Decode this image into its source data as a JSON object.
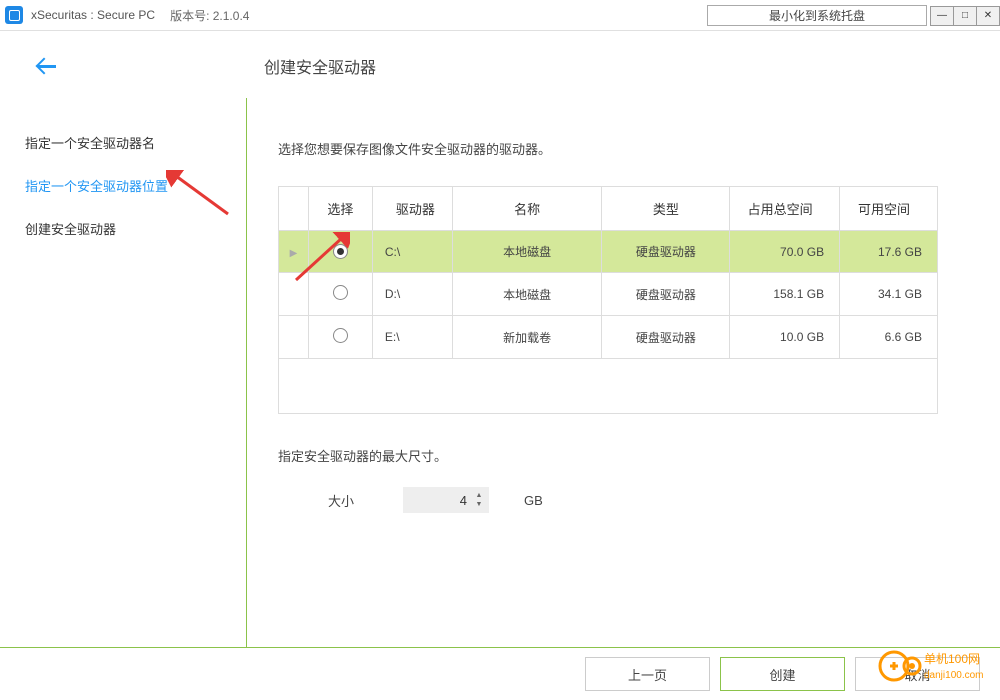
{
  "titlebar": {
    "app_name": "xSecuritas : Secure PC",
    "version_label": "版本号:",
    "version_value": "2.1.0.4",
    "tray_button": "最小化到系统托盘"
  },
  "header": {
    "page_title": "创建安全驱动器"
  },
  "sidebar": {
    "items": [
      {
        "label": "指定一个安全驱动器名",
        "active": false
      },
      {
        "label": "指定一个安全驱动器位置",
        "active": true
      },
      {
        "label": "创建安全驱动器",
        "active": false
      }
    ]
  },
  "main": {
    "description": "选择您想要保存图像文件安全驱动器的驱动器。",
    "table": {
      "headers": {
        "select": "选择",
        "drive": "驱动器",
        "name": "名称",
        "type": "类型",
        "total": "占用总空间",
        "available": "可用空间"
      },
      "rows": [
        {
          "selected": true,
          "drive": "C:\\",
          "name": "本地磁盘",
          "type": "硬盘驱动器",
          "total": "70.0 GB",
          "available": "17.6 GB"
        },
        {
          "selected": false,
          "drive": "D:\\",
          "name": "本地磁盘",
          "type": "硬盘驱动器",
          "total": "158.1 GB",
          "available": "34.1 GB"
        },
        {
          "selected": false,
          "drive": "E:\\",
          "name": "新加载卷",
          "type": "硬盘驱动器",
          "total": "10.0 GB",
          "available": "6.6 GB"
        }
      ]
    },
    "size": {
      "label": "指定安全驱动器的最大尺寸。",
      "caption": "大小",
      "value": "4",
      "unit": "GB"
    }
  },
  "footer": {
    "prev": "上一页",
    "create": "创建",
    "cancel": "取消"
  },
  "watermark": {
    "line1": "单机100网",
    "line2": "danji100.com"
  }
}
